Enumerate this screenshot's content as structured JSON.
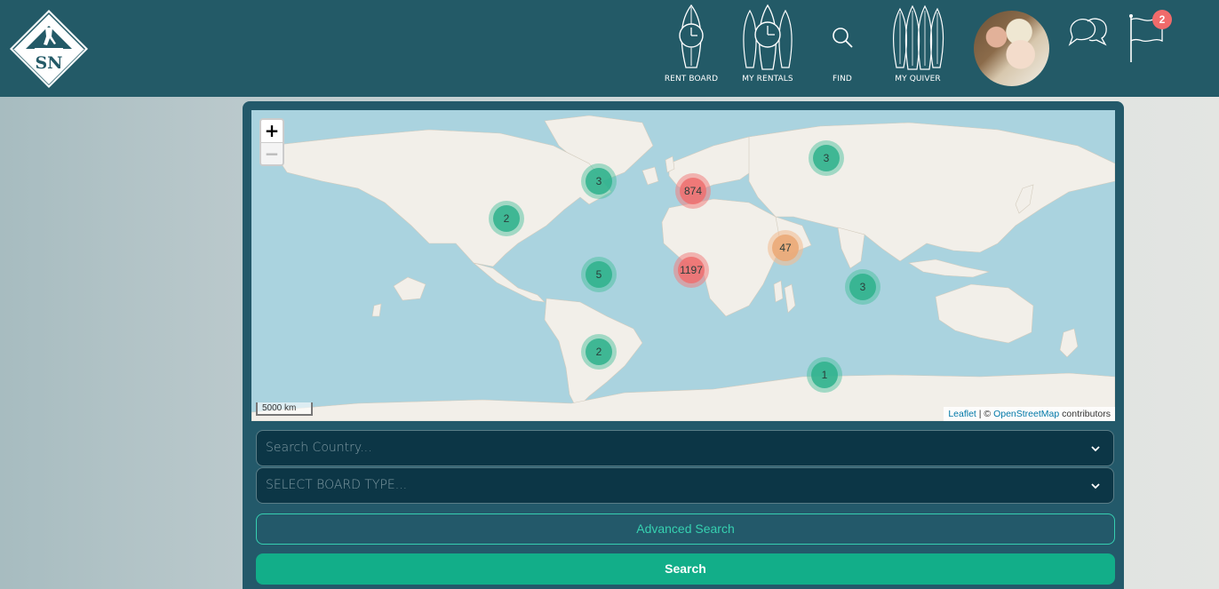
{
  "header": {
    "logo_text": "SN",
    "nav": [
      {
        "label": "RENT BOARD",
        "icon": "surfboard-clock-icon"
      },
      {
        "label": "MY RENTALS",
        "icon": "surfboards-clock-icon"
      },
      {
        "label": "FIND",
        "icon": "search-icon"
      },
      {
        "label": "MY QUIVER",
        "icon": "surfboards-quiver-icon"
      }
    ],
    "notification_count": "2",
    "icons": {
      "chat": "chat-bubbles-icon",
      "notifications": "flag-icon",
      "avatar": "user-avatar"
    }
  },
  "map": {
    "zoom_in": "+",
    "zoom_out": "−",
    "scale": "5000 km",
    "attribution": {
      "leaflet": "Leaflet",
      "sep": " | © ",
      "osm": "OpenStreetMap",
      "suffix": " contributors"
    },
    "clusters": [
      {
        "count": "3",
        "color": "green"
      },
      {
        "count": "874",
        "color": "red"
      },
      {
        "count": "3",
        "color": "green"
      },
      {
        "count": "2",
        "color": "green"
      },
      {
        "count": "47",
        "color": "orange"
      },
      {
        "count": "1197",
        "color": "red"
      },
      {
        "count": "5",
        "color": "green"
      },
      {
        "count": "3",
        "color": "green"
      },
      {
        "count": "2",
        "color": "green"
      },
      {
        "count": "1",
        "color": "green"
      }
    ]
  },
  "form": {
    "country_placeholder": "Search Country...",
    "board_type_placeholder": "SELECT BOARD TYPE...",
    "advanced_label": "Advanced Search",
    "search_label": "Search"
  },
  "colors": {
    "header_bg": "#235a67",
    "accent": "#12ae89",
    "cluster_red": "#ee6e6e",
    "cluster_green": "#2eb28c",
    "cluster_orange": "#ebaa78"
  }
}
